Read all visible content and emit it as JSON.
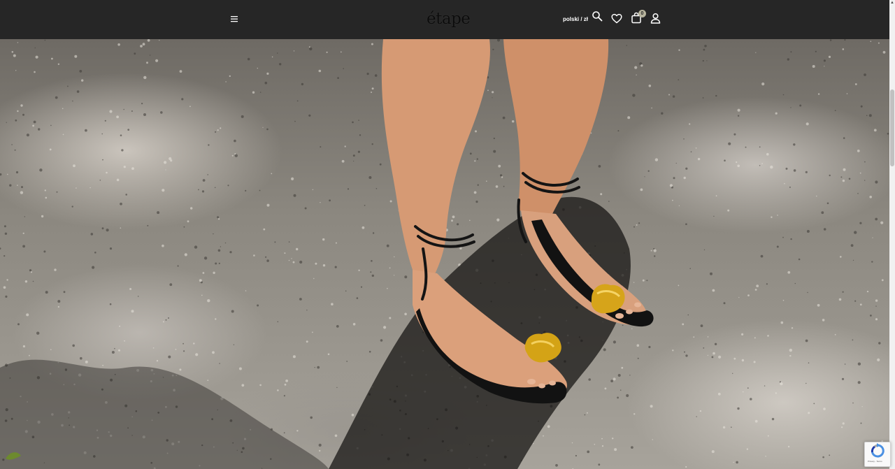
{
  "header": {
    "logo_text": "étape",
    "language_label": "polski / zł",
    "cart_count": "0",
    "background_color": "#262626"
  },
  "icons": {
    "menu": "hamburger-menu-icon",
    "search": "search-icon",
    "wishlist": "heart-icon",
    "cart": "shopping-bag-icon",
    "account": "user-icon"
  },
  "hero": {
    "image_subject": "legs wearing black strappy sandals with gold toe ornaments on gravel"
  },
  "scrollbar": {
    "up_arrow": "▲"
  },
  "recaptcha": {
    "terms_text": "Privacy - Terms"
  }
}
